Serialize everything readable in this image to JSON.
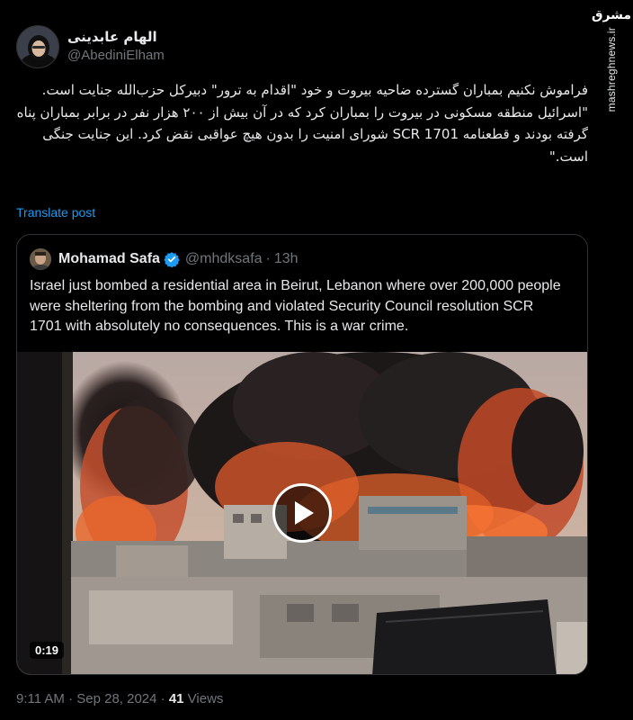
{
  "watermark": {
    "logo": "مشرق",
    "url": "mashreghnews.ir"
  },
  "author": {
    "display_name": "الهام عابدینی",
    "handle": "@AbediniElham"
  },
  "tweet": {
    "text": "فراموش نکنیم بمباران گسترده ضاحیه بیروت و خود \"اقدام به ترور\" دبیرکل حزب‌الله جنایت است.\n\"اسرائیل منطقه مسکونی در بیروت را بمباران کرد که در آن بیش از ۲۰۰ هزار نفر در برابر بمباران پناه گرفته بودند و قطعنامه SCR 1701 شورای امنیت را بدون هیچ عواقبی نقض کرد. این جنایت جنگی است.\"",
    "translate_label": "Translate post"
  },
  "quote": {
    "name": "Mohamad Safa",
    "handle": "@mhdksafa",
    "separator": "·",
    "time": "13h",
    "text": "Israel just bombed a residential area in Beirut, Lebanon where over 200,000 people were sheltering from the bombing and violated Security Council resolution SCR 1701 with absolutely no consequences. This is a war crime.",
    "video_duration": "0:19"
  },
  "meta": {
    "timestamp": "9:11 AM · Sep 28, 2024 · ",
    "views_count": "41",
    "views_label": " Views"
  },
  "icons": {
    "verified": "verified-badge-icon",
    "play": "play-icon"
  },
  "colors": {
    "background": "#000000",
    "text": "#e7e9ea",
    "secondary": "#71767b",
    "link": "#1d9bf0",
    "border": "#2f3336"
  }
}
